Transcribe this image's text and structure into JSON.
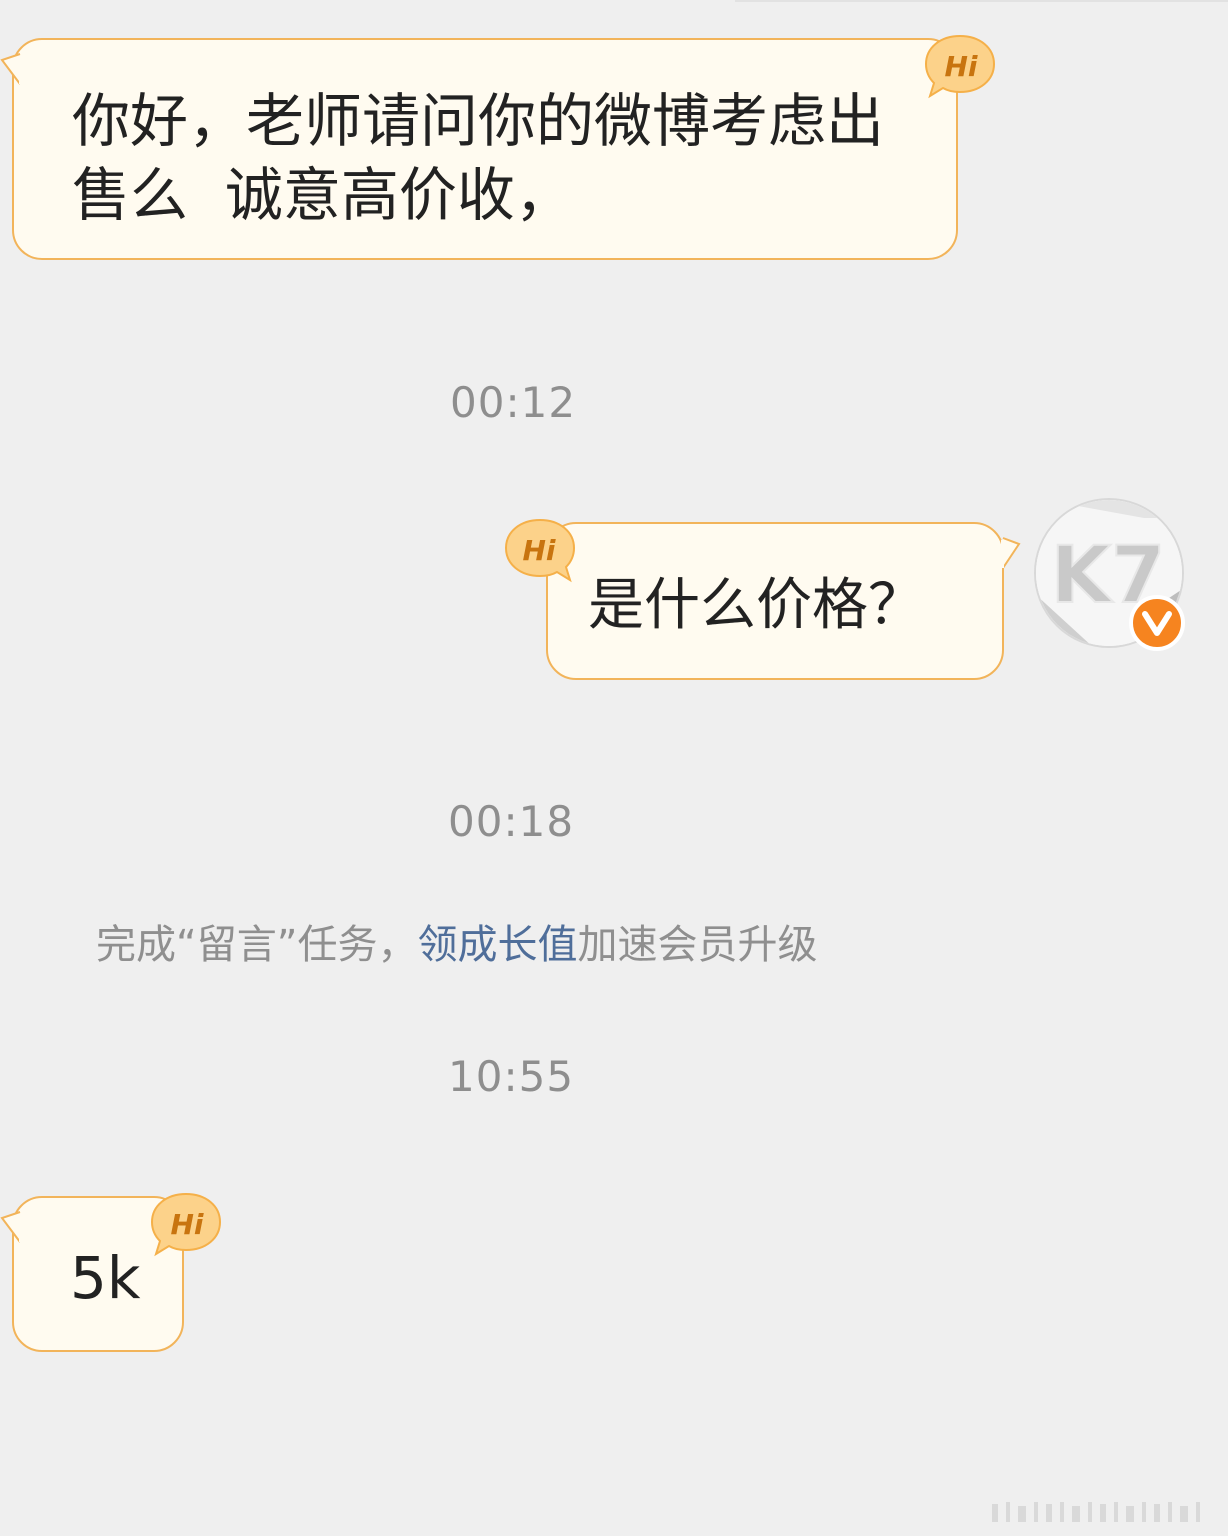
{
  "messages": [
    {
      "side": "left",
      "lines": [
        "你好，老师请问你的微博考虑出",
        "售么  诚意高价收，"
      ]
    },
    {
      "side": "right",
      "text": "是什么价格？"
    },
    {
      "side": "left",
      "text": "5k"
    }
  ],
  "timestamps": [
    "00:12",
    "00:18",
    "10:55"
  ],
  "notice": {
    "prefix": "完成“留言”任务，",
    "link": "领成长值",
    "suffix": "加速会员升级"
  },
  "badge": {
    "label": "Hi",
    "verify_label": "V"
  },
  "avatar": {
    "initials": "K7"
  },
  "colors": {
    "background": "#efefef",
    "bubble_fill": "#fffbf0",
    "bubble_border": "#f2b45a",
    "badge_fill": "#fcd28a",
    "badge_text": "#c8740f",
    "verify_orange": "#f6841f",
    "timestamp": "#8e8e8e",
    "link": "#4f6e9a"
  }
}
